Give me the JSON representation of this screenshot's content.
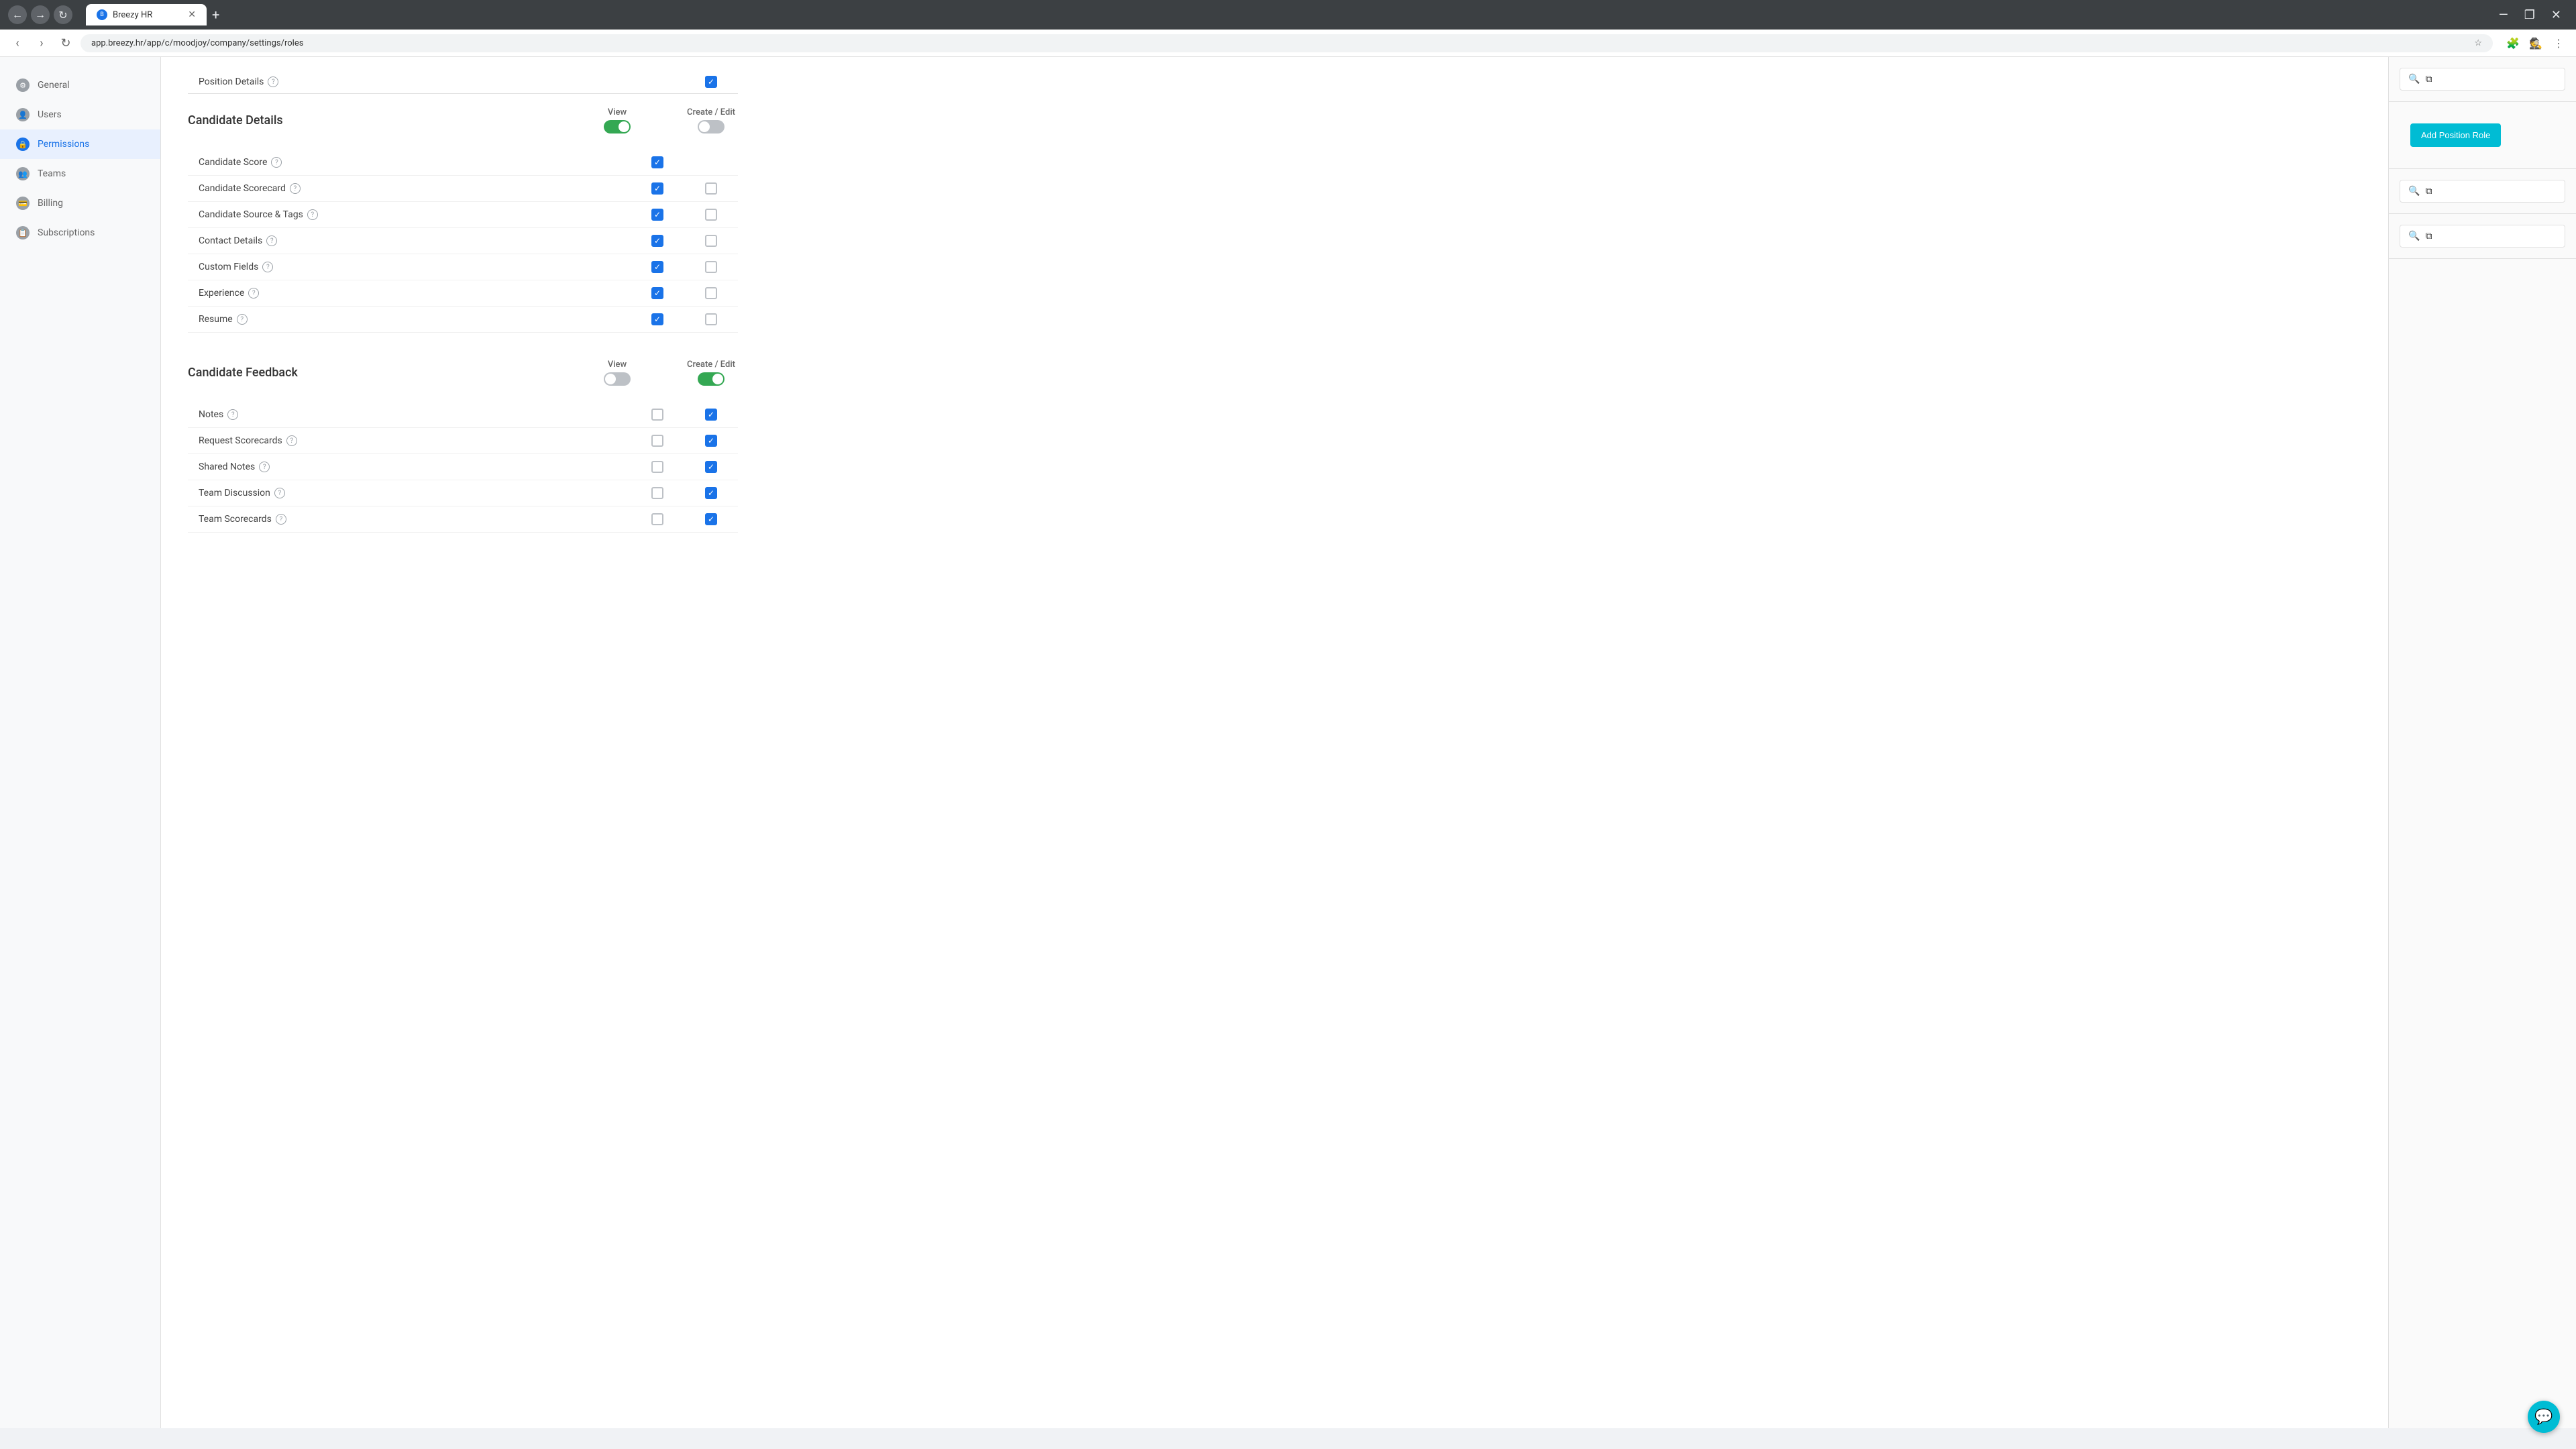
{
  "browser": {
    "tab_title": "Breezy HR",
    "url": "app.breezy.hr/app/c/moodjoy/company/settings/roles",
    "nav_back": "←",
    "nav_forward": "→",
    "nav_refresh": "↻",
    "new_tab": "+",
    "incognito_label": "Incognito",
    "window_minimize": "—",
    "window_restore": "❐",
    "window_close": "✕"
  },
  "sidebar": {
    "items": [
      {
        "id": "general",
        "label": "General",
        "active": false
      },
      {
        "id": "users",
        "label": "Users",
        "active": false
      },
      {
        "id": "permissions",
        "label": "Permissions",
        "active": true
      },
      {
        "id": "teams",
        "label": "Teams",
        "active": false
      },
      {
        "id": "billing",
        "label": "Billing",
        "active": false
      },
      {
        "id": "subscriptions",
        "label": "Subscriptions",
        "active": false
      }
    ]
  },
  "top_item": {
    "label": "Position Details",
    "view_checked": true
  },
  "candidate_details": {
    "section_title": "Candidate Details",
    "view_label": "View",
    "create_edit_label": "Create / Edit",
    "view_toggle": "on",
    "create_edit_toggle": "off",
    "rows": [
      {
        "label": "Candidate Score",
        "view_checked": true,
        "edit_checked": false,
        "edit_visible": false
      },
      {
        "label": "Candidate Scorecard",
        "view_checked": true,
        "edit_checked": false,
        "edit_visible": true
      },
      {
        "label": "Candidate Source & Tags",
        "view_checked": true,
        "edit_checked": false,
        "edit_visible": true
      },
      {
        "label": "Contact Details",
        "view_checked": true,
        "edit_checked": false,
        "edit_visible": true
      },
      {
        "label": "Custom Fields",
        "view_checked": true,
        "edit_checked": false,
        "edit_visible": true
      },
      {
        "label": "Experience",
        "view_checked": true,
        "edit_checked": false,
        "edit_visible": true
      },
      {
        "label": "Resume",
        "view_checked": true,
        "edit_checked": false,
        "edit_visible": true
      }
    ]
  },
  "candidate_feedback": {
    "section_title": "Candidate Feedback",
    "view_label": "View",
    "create_edit_label": "Create / Edit",
    "view_toggle": "off",
    "create_edit_toggle": "on",
    "rows": [
      {
        "label": "Notes",
        "view_checked": false,
        "edit_checked": true
      },
      {
        "label": "Request Scorecards",
        "view_checked": false,
        "edit_checked": true
      },
      {
        "label": "Shared Notes",
        "view_checked": false,
        "edit_checked": true
      },
      {
        "label": "Team Discussion",
        "view_checked": false,
        "edit_checked": true
      },
      {
        "label": "Team Scorecards",
        "view_checked": false,
        "edit_checked": true
      }
    ]
  },
  "right_panel": {
    "add_position_role_label": "Add Position Role"
  },
  "chat": {
    "icon": "💬"
  }
}
